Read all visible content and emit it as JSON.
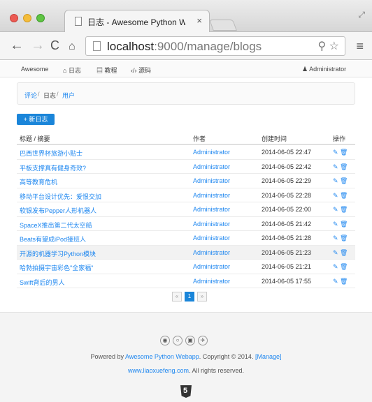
{
  "browser": {
    "tab_title": "日志 - Awesome Python W",
    "tab_close": "×",
    "url_host": "localhost",
    "url_path": ":9000/manage/blogs",
    "icons": [
      "back-icon",
      "forward-icon",
      "reload-icon",
      "home-icon",
      "search-icon",
      "star-icon",
      "menu-icon"
    ]
  },
  "navbar": {
    "brand": "Awesome",
    "items": [
      {
        "icon": "home-icon",
        "label": "日志"
      },
      {
        "icon": "book-icon",
        "label": "教程"
      },
      {
        "icon": "code-icon",
        "label": "源码"
      }
    ],
    "user": "Administrator"
  },
  "breadcrumb": {
    "items": [
      "评论",
      "日志",
      "用户"
    ],
    "separator": "/"
  },
  "new_button": "+ 新日志",
  "table": {
    "headers": [
      "标题 / 摘要",
      "作者",
      "创建时间",
      "操作"
    ],
    "rows": [
      {
        "title": "巴西世界杯旅游小贴士",
        "author": "Administrator",
        "created": "2014-06-05 22:47"
      },
      {
        "title": "平板支撑真有健身奇效?",
        "author": "Administrator",
        "created": "2014-06-05 22:42"
      },
      {
        "title": "高等教育危机",
        "author": "Administrator",
        "created": "2014-06-05 22:29"
      },
      {
        "title": "移动平台设计优先：爱恨交加",
        "author": "Administrator",
        "created": "2014-06-05 22:28"
      },
      {
        "title": "软银发布Pepper人形机器人",
        "author": "Administrator",
        "created": "2014-06-05 22:00"
      },
      {
        "title": "SpaceX推出第二代太空船",
        "author": "Administrator",
        "created": "2014-06-05 21:42"
      },
      {
        "title": "Beats有望成iPod接班人",
        "author": "Administrator",
        "created": "2014-06-05 21:28"
      },
      {
        "title": "开源的机器学习Python模块",
        "author": "Administrator",
        "created": "2014-06-05 21:23"
      },
      {
        "title": "哈勃拍摄宇宙彩色\"全家福\"",
        "author": "Administrator",
        "created": "2014-06-05 21:21"
      },
      {
        "title": "Swift背后的男人",
        "author": "Administrator",
        "created": "2014-06-05 17:55"
      }
    ],
    "highlighted_row": 7
  },
  "pagination": {
    "prev": "«",
    "current": "1",
    "next": "»"
  },
  "footer": {
    "social_icons": [
      "weibo-icon",
      "github-icon",
      "linkedin-icon",
      "twitter-icon"
    ],
    "powered_prefix": "Powered by ",
    "powered_link": "Awesome Python Webapp",
    "copyright": ". Copyright © 2014. ",
    "manage_link": "[Manage]",
    "site_link": "www.liaoxuefeng.com",
    "rights": ". All rights reserved.",
    "badge": "5"
  },
  "colors": {
    "accent": "#1a85d9",
    "link": "#1e87f0"
  }
}
